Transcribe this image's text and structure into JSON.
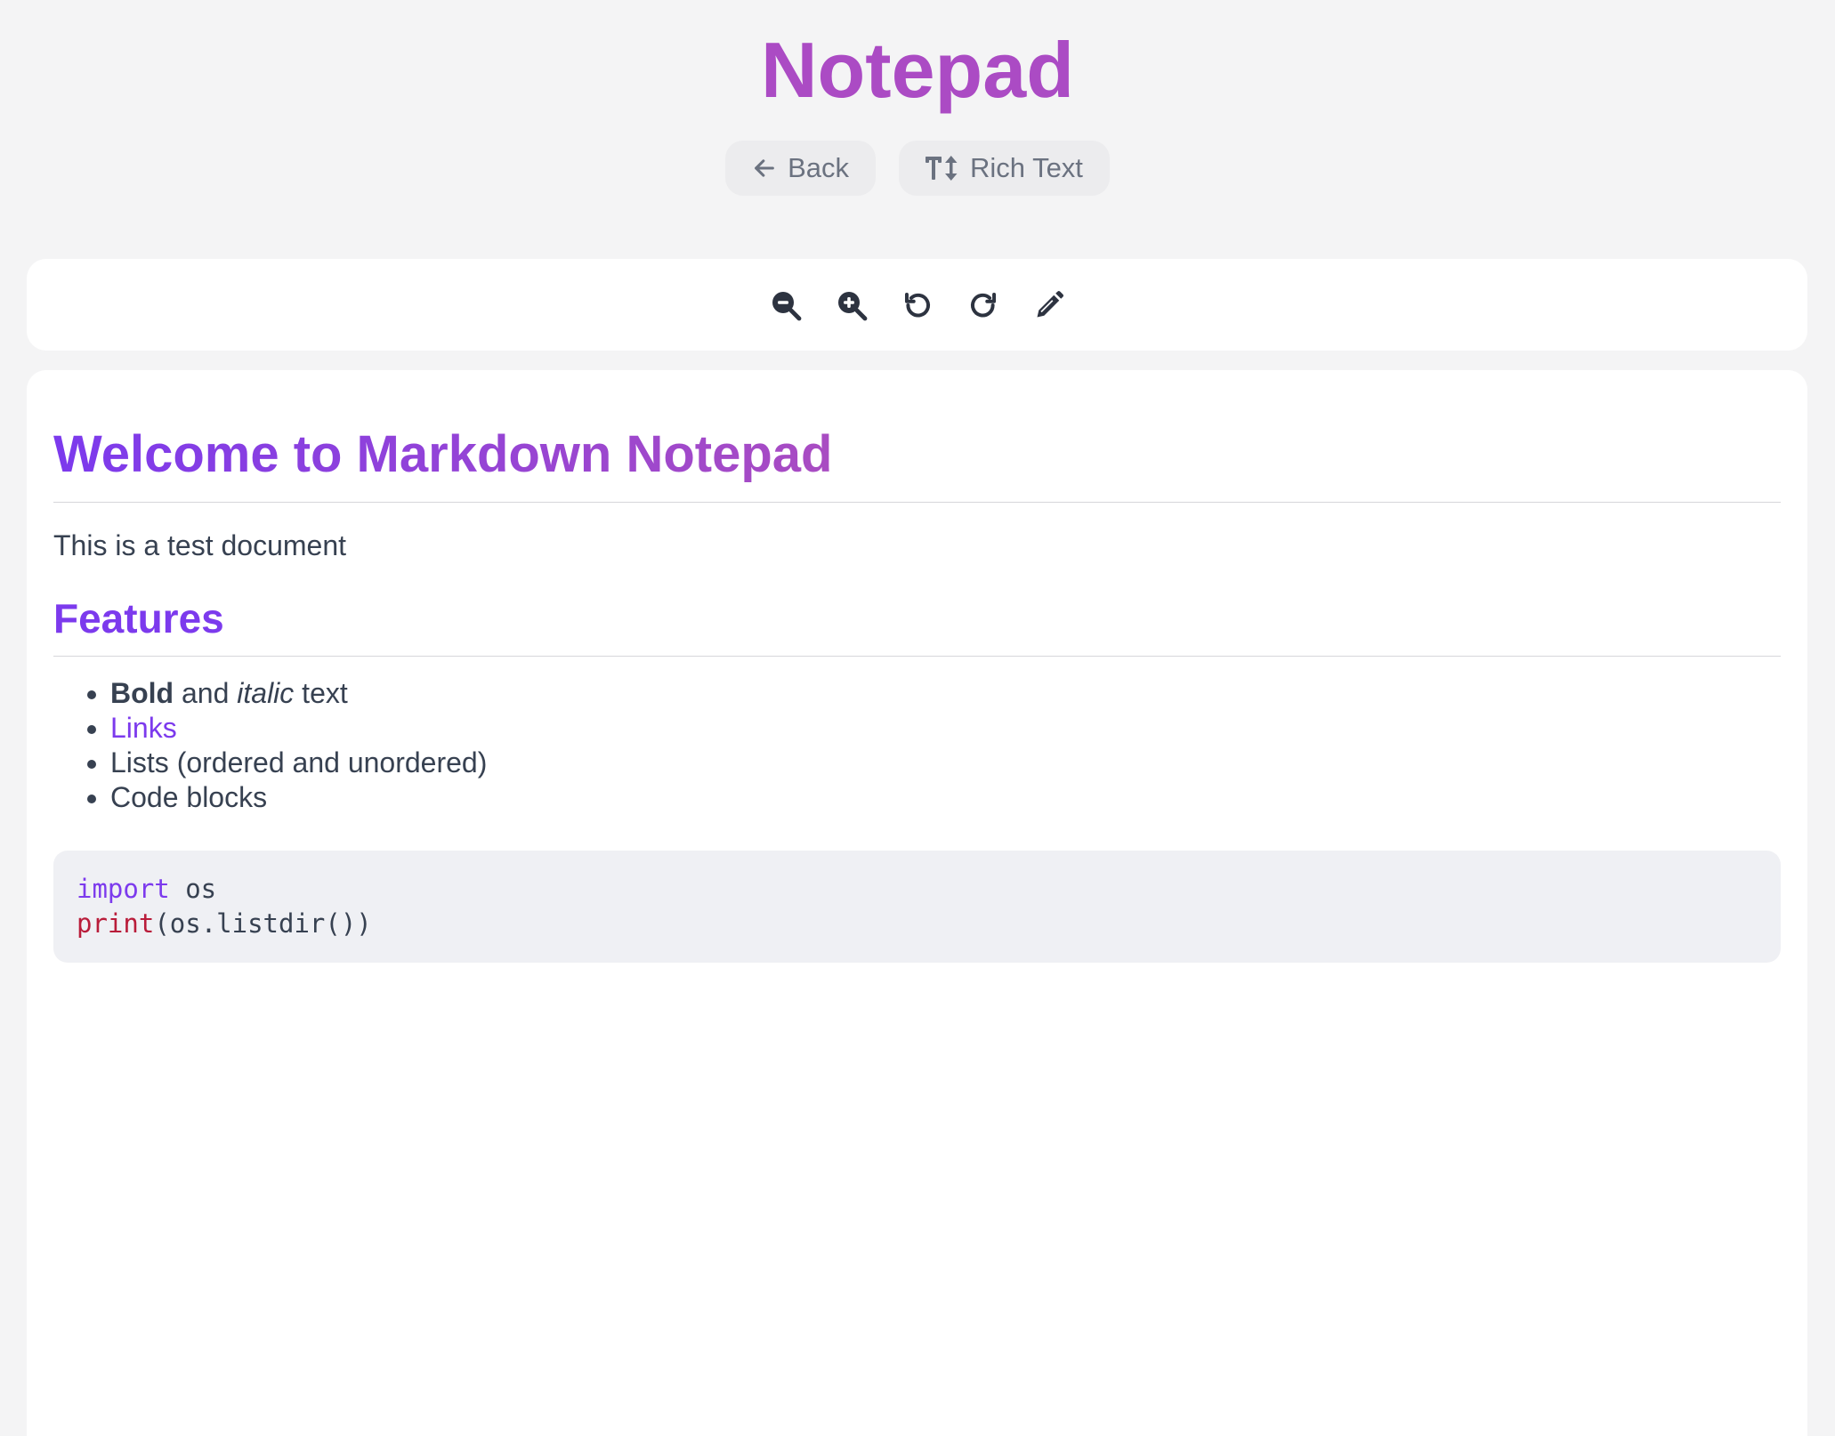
{
  "app": {
    "title": "Notepad"
  },
  "nav": {
    "back": {
      "label": "Back",
      "icon": "arrow-left-icon"
    },
    "rich_text": {
      "label": "Rich Text",
      "icon": "text-height-icon"
    }
  },
  "toolbar": {
    "tools": [
      {
        "name": "zoom-out",
        "icon": "zoom-out-icon"
      },
      {
        "name": "zoom-in",
        "icon": "zoom-in-icon"
      },
      {
        "name": "undo",
        "icon": "undo-icon"
      },
      {
        "name": "redo",
        "icon": "redo-icon"
      },
      {
        "name": "edit",
        "icon": "pencil-icon"
      }
    ]
  },
  "document": {
    "heading": "Welcome to Markdown Notepad",
    "paragraph": "This is a test document",
    "subheading": "Features",
    "features": {
      "item1": {
        "bold": "Bold",
        "mid": " and ",
        "italic": "italic",
        "end": " text"
      },
      "item2": {
        "link": "Links"
      },
      "item3": "Lists (ordered and unordered)",
      "item4": "Code blocks"
    },
    "code": {
      "line1": {
        "keyword": "import",
        "rest": " os"
      },
      "line2": {
        "func": "print",
        "rest": "(os.listdir())"
      }
    }
  },
  "colors": {
    "accent": "#7c3aed",
    "title": "#ab4bc4",
    "background": "#f4f4f5",
    "text": "#374151",
    "code_bg": "#eff0f4",
    "code_func": "#b91c3a"
  }
}
